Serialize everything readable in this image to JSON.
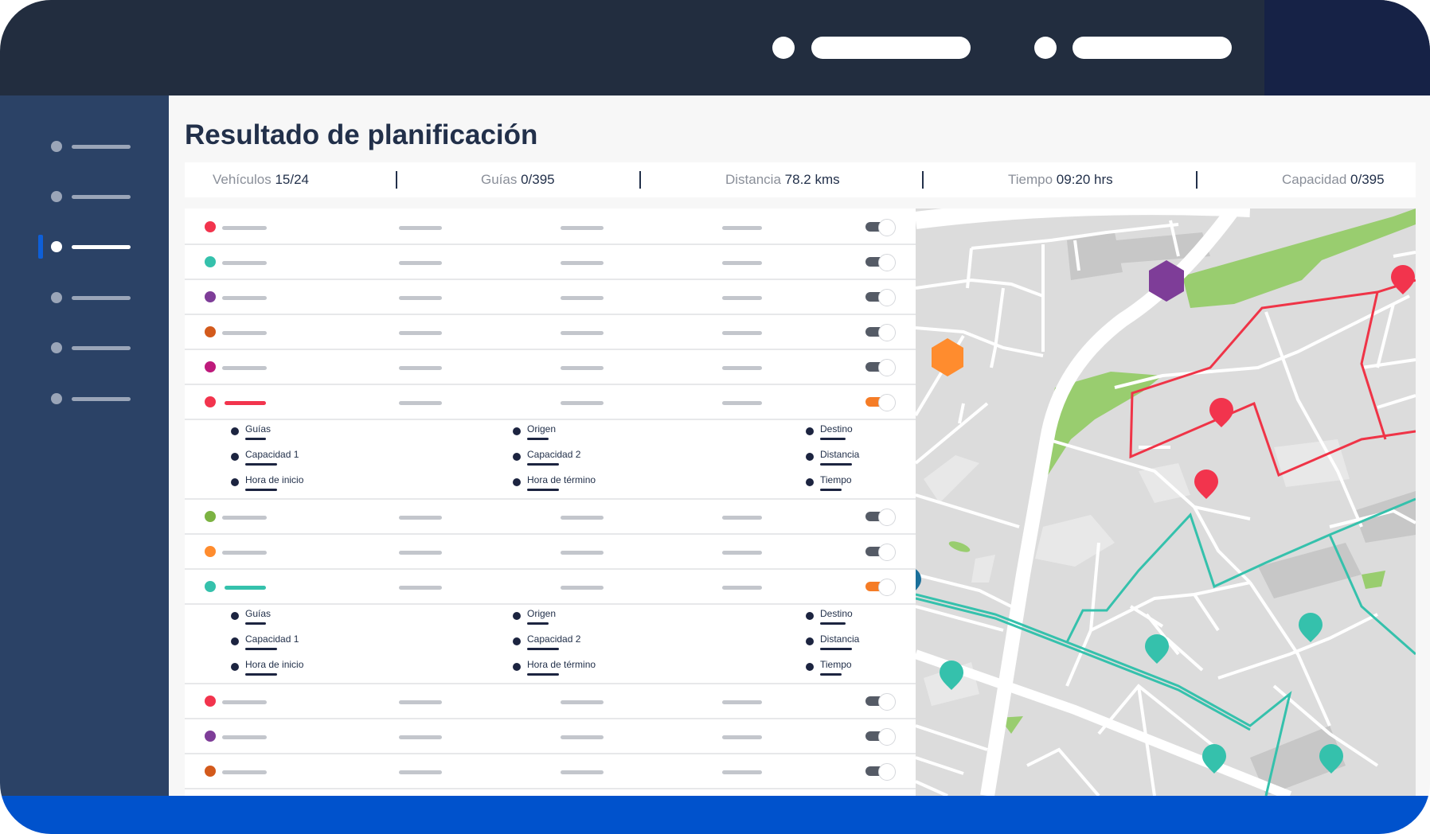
{
  "page": {
    "title": "Resultado de planificación"
  },
  "stats": [
    {
      "label": "Vehículos",
      "value": "15/24"
    },
    {
      "label": "Guías",
      "value": "0/395"
    },
    {
      "label": "Distancia",
      "value": "78.2 kms"
    },
    {
      "label": "Tiempo",
      "value": "09:20 hrs"
    },
    {
      "label": "Capacidad",
      "value": "0/395"
    }
  ],
  "details": {
    "col1": [
      "Guías",
      "Capacidad 1",
      "Hora de inicio"
    ],
    "col2": [
      "Origen",
      "Capacidad 2",
      "Hora de término"
    ],
    "col3": [
      "Destino",
      "Distancia",
      "Tiempo"
    ]
  },
  "colors": {
    "red": "#f2344d",
    "teal": "#35c1ac",
    "purple": "#7e3d98",
    "orange_dark": "#d35a1c",
    "magenta": "#be1a7b",
    "green": "#7cb342",
    "orange": "#ff8c2e",
    "toggle_on": "#f57c26",
    "toggle_off": "#555b66",
    "topbar": "#222d3f",
    "sidebar": "#2b4266",
    "accent": "#0052cc"
  },
  "rows": [
    {
      "color": "red",
      "toggle": "off"
    },
    {
      "color": "teal",
      "toggle": "off"
    },
    {
      "color": "purple",
      "toggle": "off"
    },
    {
      "color": "orange_dark",
      "toggle": "off"
    },
    {
      "color": "magenta",
      "toggle": "off"
    },
    {
      "color": "red",
      "toggle": "on",
      "expanded": true
    },
    {
      "color": "green",
      "toggle": "off"
    },
    {
      "color": "orange",
      "toggle": "off"
    },
    {
      "color": "teal",
      "toggle": "on",
      "expanded": true
    },
    {
      "color": "red",
      "toggle": "off"
    },
    {
      "color": "purple",
      "toggle": "off"
    },
    {
      "color": "orange_dark",
      "toggle": "off"
    }
  ],
  "sidebar": {
    "item_count": 6,
    "active_index": 2
  },
  "map": {
    "icons": [
      "depot-hexagon-purple",
      "depot-hexagon-orange",
      "map-pin-red",
      "map-pin-teal"
    ]
  }
}
